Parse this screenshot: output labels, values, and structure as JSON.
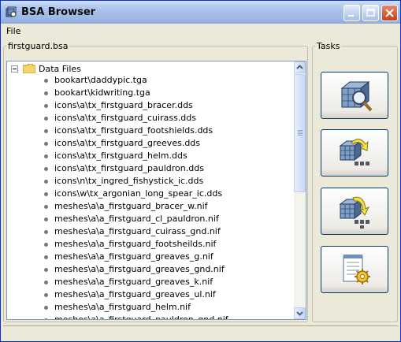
{
  "window": {
    "title": "BSA Browser"
  },
  "menu": {
    "file_label": "File"
  },
  "archive": {
    "name": "firstguard.bsa"
  },
  "tasks": {
    "label": "Tasks",
    "buttons": [
      {
        "icon": "cube-magnifier-icon"
      },
      {
        "icon": "cube-extract-icon"
      },
      {
        "icon": "cube-extract-all-icon"
      },
      {
        "icon": "settings-notepad-icon"
      }
    ]
  },
  "tree": {
    "root_label": "Data Files",
    "items": [
      "bookart\\daddypic.tga",
      "bookart\\kidwriting.tga",
      "icons\\a\\tx_firstguard_bracer.dds",
      "icons\\a\\tx_firstguard_cuirass.dds",
      "icons\\a\\tx_firstguard_footshields.dds",
      "icons\\a\\tx_firstguard_greeves.dds",
      "icons\\a\\tx_firstguard_helm.dds",
      "icons\\a\\tx_firstguard_pauldron.dds",
      "icons\\n\\tx_ingred_fishystick_ic.dds",
      "icons\\w\\tx_argonian_long_spear_ic.dds",
      "meshes\\a\\a_firstguard_bracer_w.nif",
      "meshes\\a\\a_firstguard_cl_pauldron.nif",
      "meshes\\a\\a_firstguard_cuirass_gnd.nif",
      "meshes\\a\\a_firstguard_footsheilds.nif",
      "meshes\\a\\a_firstguard_greaves_g.nif",
      "meshes\\a\\a_firstguard_greaves_gnd.nif",
      "meshes\\a\\a_firstguard_greaves_k.nif",
      "meshes\\a\\a_firstguard_greaves_ul.nif",
      "meshes\\a\\a_firstguard_helm.nif",
      "meshes\\a\\a_firstguard_pauldron_gnd.nif"
    ]
  },
  "colors": {
    "titlebar": "#a8c0ea",
    "close_button": "#c6401c",
    "window_bg": "#ece9d8"
  }
}
